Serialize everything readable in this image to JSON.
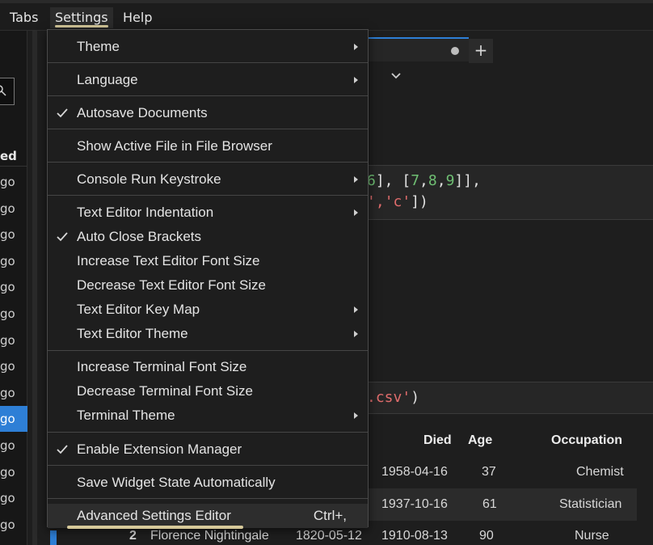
{
  "menubar": {
    "items": [
      "Tabs",
      "Settings",
      "Help"
    ]
  },
  "sidebar": {
    "column_header": "ed",
    "rows": [
      "go",
      "go",
      "go",
      "go",
      "go",
      "go",
      "go",
      "go",
      "go",
      "go",
      "go",
      "go",
      "go",
      "go"
    ],
    "selected_index": 9
  },
  "editor": {
    "add_tab_label": "+",
    "code1": {
      "line1_num1": "6",
      "line1_mid": "], [",
      "line1_nums": [
        "7",
        "8",
        "9"
      ],
      "line1_end": "]],",
      "line2_pre": "',",
      "line2_str": "'c'",
      "line2_end": "])"
    },
    "code2": {
      "str": ".csv'",
      "end": ")"
    }
  },
  "table": {
    "headers": [
      "Died",
      "Age",
      "Occupation"
    ],
    "rows": [
      [
        "1958-04-16",
        "37",
        "Chemist"
      ],
      [
        "1937-10-16",
        "61",
        "Statistician"
      ]
    ],
    "partial_row": [
      "2",
      "Florence Nightingale",
      "1820-05-12",
      "1910-08-13",
      "90",
      "Nurse"
    ]
  },
  "settings_menu": {
    "items": [
      {
        "label": "Theme",
        "submenu": true,
        "checked": false
      },
      {
        "label": "Language",
        "submenu": true,
        "checked": false
      },
      {
        "label": "Autosave Documents",
        "submenu": false,
        "checked": true
      },
      {
        "label": "Show Active File in File Browser",
        "submenu": false,
        "checked": false
      },
      {
        "label": "Console Run Keystroke",
        "submenu": true,
        "checked": false
      },
      {
        "label": "Text Editor Indentation",
        "submenu": true,
        "checked": false
      },
      {
        "label": "Auto Close Brackets",
        "submenu": false,
        "checked": true
      },
      {
        "label": "Increase Text Editor Font Size",
        "submenu": false,
        "checked": false
      },
      {
        "label": "Decrease Text Editor Font Size",
        "submenu": false,
        "checked": false
      },
      {
        "label": "Text Editor Key Map",
        "submenu": true,
        "checked": false
      },
      {
        "label": "Text Editor Theme",
        "submenu": true,
        "checked": false
      },
      {
        "label": "Increase Terminal Font Size",
        "submenu": false,
        "checked": false
      },
      {
        "label": "Decrease Terminal Font Size",
        "submenu": false,
        "checked": false
      },
      {
        "label": "Terminal Theme",
        "submenu": true,
        "checked": false
      },
      {
        "label": "Enable Extension Manager",
        "submenu": false,
        "checked": true
      },
      {
        "label": "Save Widget State Automatically",
        "submenu": false,
        "checked": false
      },
      {
        "label": "Advanced Settings Editor",
        "submenu": false,
        "checked": false,
        "shortcut": "Ctrl+,"
      }
    ]
  },
  "colors": {
    "accent": "#2e7fd6",
    "highlight_underline": "#d6c99a",
    "menu_bg": "#1e1e1e",
    "number_green": "#6fbf73",
    "string_red": "#e06c6c"
  },
  "icons": [
    "search-icon",
    "chevron-down-icon",
    "check-icon",
    "submenu-arrow-icon"
  ]
}
